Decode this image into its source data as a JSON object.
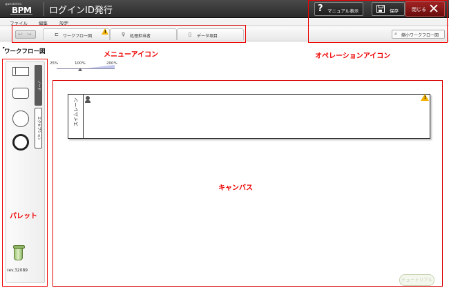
{
  "header": {
    "logo_small": "questetra",
    "logo_main": "BPM",
    "title": "ログインID発行",
    "buttons": {
      "manual": "マニュアル表示",
      "save": "保存",
      "close": "閉じる"
    }
  },
  "menu": {
    "items": [
      "ファイル",
      "編集",
      "設定"
    ]
  },
  "toolbar": {
    "undo_glyph": "↩",
    "redo_glyph": "↪",
    "tabs": [
      {
        "label": "ワークフロー図",
        "icon": "workflow-icon",
        "glyph": "⊏",
        "warning": true
      },
      {
        "label": "処理担当者",
        "icon": "person-icon",
        "glyph": "♀"
      },
      {
        "label": "データ項目",
        "icon": "document-icon",
        "glyph": "▯"
      }
    ],
    "minimap_button": "縮小ワークフロー図",
    "minimap_glyph": "⌕"
  },
  "workflow": {
    "section_title": "ワークフロー図",
    "zoom": {
      "labels": [
        "25%",
        "100%",
        "200%"
      ],
      "current_percent": 100
    }
  },
  "palette": {
    "tabs": [
      "ノード",
      "エクセプション"
    ],
    "rev": "rev.32089"
  },
  "canvas": {
    "swimlane_label": "スイムレーン",
    "tutorial_button": "チュートリアル"
  },
  "annotations": {
    "menu_icon": "メニューアイコン",
    "operation_icon": "オペレーションアイコン",
    "canvas": "キャンバス",
    "palette": "パレット"
  },
  "colors": {
    "annotation": "#e00000",
    "close_button": "#8a1515",
    "header": "#333333"
  }
}
